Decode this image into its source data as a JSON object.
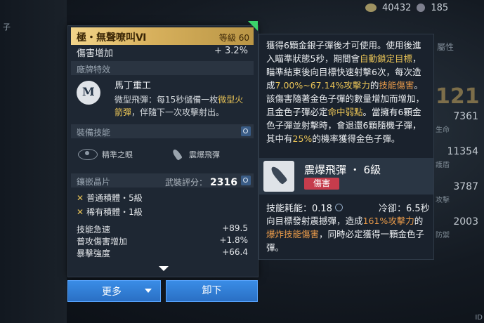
{
  "topbar": {
    "coins": "40432",
    "gems": "185"
  },
  "right_panel": {
    "title": "屬性",
    "big_value": "121",
    "stats": [
      {
        "value": "7361",
        "label": "生命"
      },
      {
        "value": "11354",
        "label": "護盾"
      },
      {
        "value": "3787",
        "label": "攻擊"
      },
      {
        "value": "2003",
        "label": "防禦"
      }
    ],
    "edge_text": "ID"
  },
  "left_edge": [
    "子"
  ],
  "card": {
    "name": "極・無聲嘹叫Ⅵ",
    "level": "等級 60",
    "damage_label": "傷害增加",
    "damage_value": "+ 3.2%",
    "vendor_section": "廠牌特效",
    "brand": "馬丁重工",
    "desc_prefix": "微型飛彈：每15秒儲備一枚",
    "desc_hl": "微型火箭彈",
    "desc_suffix": "，伴隨下一次攻擊射出。",
    "equip_section": "裝備技能",
    "skills": [
      "精準之眼",
      "震爆飛彈"
    ],
    "chip_section": "鑲嵌晶片",
    "score_label": "武裝評分：",
    "score_value": "2316",
    "chips": [
      "普通積體・5級",
      "稀有積體・1級"
    ],
    "stats": [
      {
        "label": "技能急速",
        "value": "+89.5"
      },
      {
        "label": "普攻傷害增加",
        "value": "+1.8%"
      },
      {
        "label": "暴擊強度",
        "value": "+66.4"
      }
    ]
  },
  "buttons": {
    "more": "更多",
    "unequip": "卸下"
  },
  "tooltip": {
    "p1": "獲得6顆金銀子彈後才可使用。使用後進入瞄準狀態5秒，期間會",
    "p1_hl1": "自動鎖定目標",
    "p1b": "，瞄準結束後向目標快速射擊6次，每次造成",
    "p1_hl2": "7.00%~67.14%攻擊力",
    "p1c": "的",
    "p1_hl3": "技能傷害",
    "p1d": "。該傷害隨著金色子彈的數量增加而增加，且金色子彈必定",
    "p1_hl4": "命中弱點",
    "p1e": "。當擁有6顆金色子彈並射擊時，會退還6顆隨機子彈，其中有",
    "p1_hl5": "25%",
    "p1f": "的機率獲得金色子彈。",
    "skill_name": "震爆飛彈 ・ 6級",
    "skill_tag": "傷害",
    "cost_label": "技能耗能：0.18",
    "cooldown": "冷卻：6.5秒",
    "d1": "向目標發射震撼彈，造成",
    "d1_hl": "161%攻擊力",
    "d2": "的",
    "d2_hl": "爆炸技能傷害",
    "d3": "，同時必定獲得一顆金色子彈。"
  }
}
